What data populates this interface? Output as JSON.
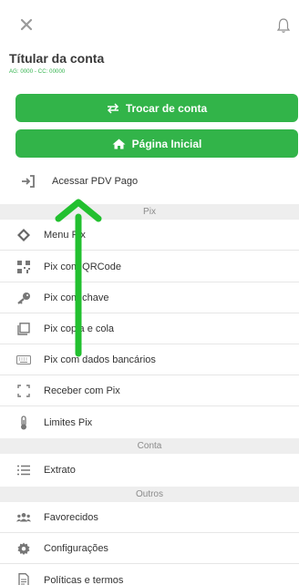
{
  "header": {
    "title": "Títular da conta",
    "account_info": "AG: 0000 - CC: 00000"
  },
  "buttons": {
    "switch_account": "Trocar de conta",
    "home": "Página Inicial"
  },
  "pdv_item": "Acessar PDV Pago",
  "sections": {
    "pix": "Pix",
    "conta": "Conta",
    "outros": "Outros"
  },
  "pix_items": [
    {
      "label": "Menu Pix",
      "icon": "pix-diamond-icon"
    },
    {
      "label": "Pix com QRCode",
      "icon": "qrcode-icon"
    },
    {
      "label": "Pix com chave",
      "icon": "key-icon"
    },
    {
      "label": "Pix copia e cola",
      "icon": "copy-icon"
    },
    {
      "label": "Pix com dados bancários",
      "icon": "keyboard-icon"
    },
    {
      "label": "Receber com Pix",
      "icon": "scan-frame-icon"
    },
    {
      "label": "Limites Pix",
      "icon": "thermometer-icon"
    }
  ],
  "conta_items": [
    {
      "label": "Extrato",
      "icon": "list-icon"
    }
  ],
  "outros_items": [
    {
      "label": "Favorecidos",
      "icon": "users-icon"
    },
    {
      "label": "Configurações",
      "icon": "gear-icon"
    },
    {
      "label": "Políticas e termos",
      "icon": "document-icon"
    }
  ],
  "colors": {
    "accent_green": "#32b449",
    "annotation_arrow": "#22c02f"
  }
}
